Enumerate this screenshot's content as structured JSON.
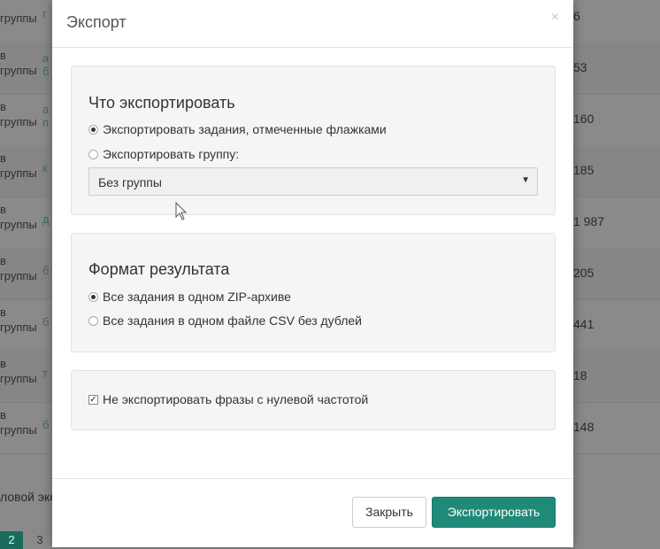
{
  "background": {
    "rows": [
      {
        "left": "в\nгруппы",
        "mid": "г",
        "num": "6"
      },
      {
        "left": "в\nгруппы",
        "mid": "а\nб",
        "num": "53"
      },
      {
        "left": "в\nгруппы",
        "mid": "а\nп",
        "num": "160"
      },
      {
        "left": "в\nгруппы",
        "mid": "к",
        "num": "185"
      },
      {
        "left": "в\nгруппы",
        "mid": "д",
        "num": "1 987"
      },
      {
        "left": "в\nгруппы",
        "mid": "б",
        "num": "205"
      },
      {
        "left": "в\nгруппы",
        "mid": "б",
        "num": "441"
      },
      {
        "left": "в\nгруппы",
        "mid": "т",
        "num": "18"
      },
      {
        "left": "в\nгруппы",
        "mid": "б",
        "num": "148"
      }
    ],
    "footer_text": "ловой эксп",
    "pagination": [
      "2",
      "3"
    ]
  },
  "modal": {
    "title": "Экспорт",
    "close_symbol": "×",
    "what_section": {
      "heading": "Что экспортировать",
      "option_selected": "Экспортировать задания, отмеченные флажками",
      "option_group": "Экспортировать группу:",
      "group_select_value": "Без группы"
    },
    "format_section": {
      "heading": "Формат результата",
      "option_zip": "Все задания в одном ZIP-архиве",
      "option_csv": "Все задания в одном файле CSV без дублей"
    },
    "zero_freq_checkbox": "Не экспортировать фразы с нулевой частотой",
    "buttons": {
      "close": "Закрыть",
      "export": "Экспортировать"
    }
  },
  "colors": {
    "accent": "#1f8a77",
    "overlay": "#8a8a8a"
  }
}
